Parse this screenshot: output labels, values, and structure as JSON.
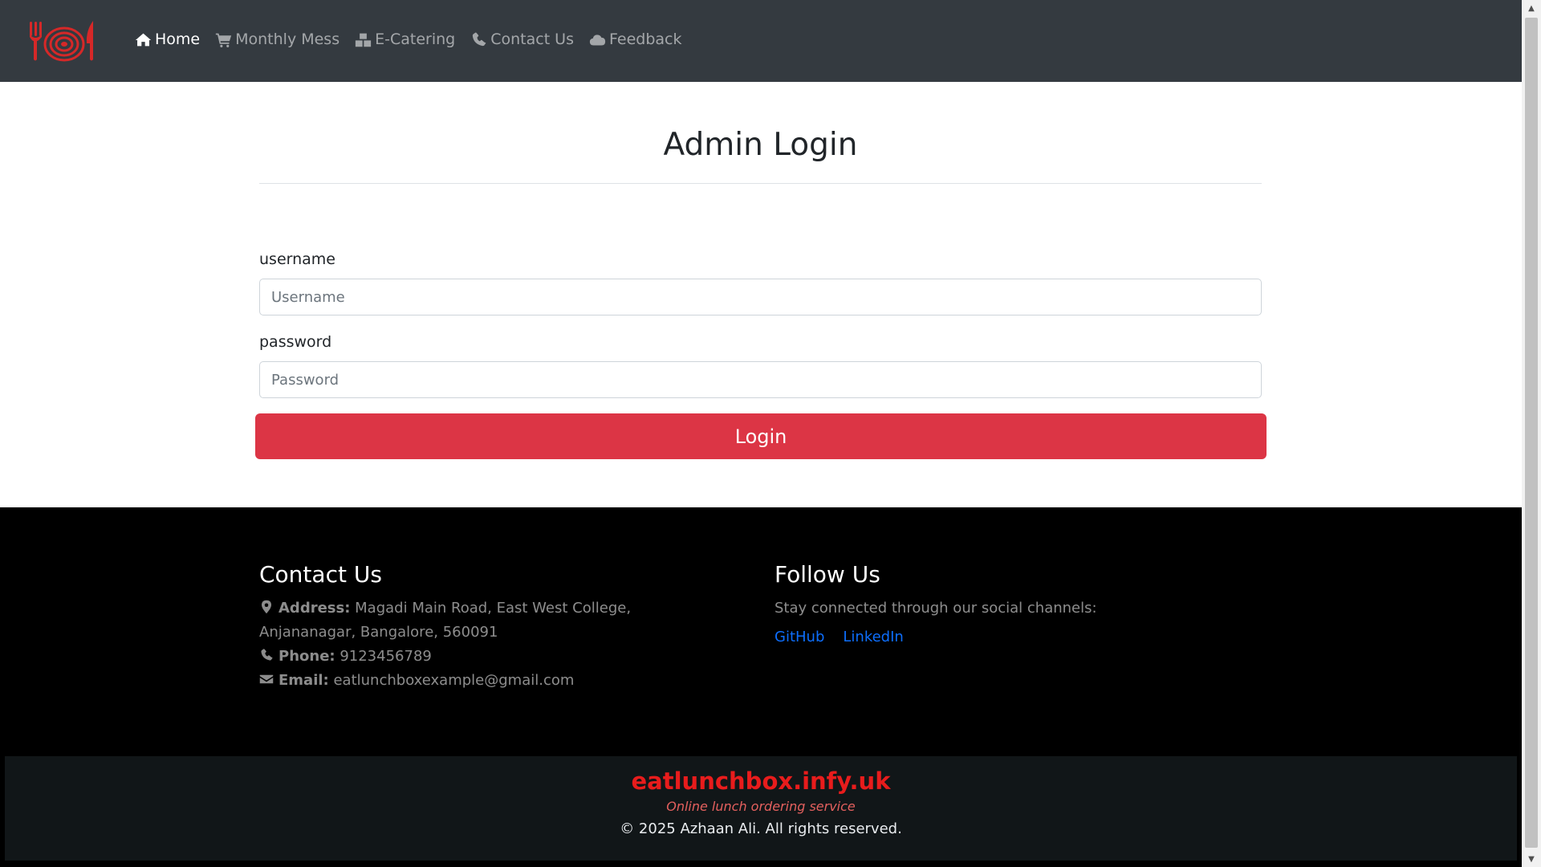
{
  "nav": {
    "logo_icon": "fork-plate-knife-logo",
    "brand_color": "#d62828",
    "items": [
      {
        "label": "Home",
        "icon": "home-icon",
        "active": true
      },
      {
        "label": "Monthly Mess",
        "icon": "cart-icon",
        "active": false
      },
      {
        "label": "E-Catering",
        "icon": "boxes-icon",
        "active": false
      },
      {
        "label": "Contact Us",
        "icon": "phone-icon",
        "active": false
      },
      {
        "label": "Feedback",
        "icon": "cloud-icon",
        "active": false
      }
    ]
  },
  "login": {
    "title": "Admin Login",
    "username_label": "username",
    "username_placeholder": "Username",
    "username_value": "",
    "password_label": "password",
    "password_placeholder": "Password",
    "password_value": "",
    "submit_label": "Login",
    "submit_color": "#dc3545"
  },
  "footer": {
    "contact": {
      "heading": "Contact Us",
      "address_label": "Address:",
      "address_value": "Magadi Main Road, East West College, Anjananagar, Bangalore, 560091",
      "phone_label": "Phone:",
      "phone_value": "9123456789",
      "email_label": "Email:",
      "email_value": "eatlunchboxexample@gmail.com"
    },
    "follow": {
      "heading": "Follow Us",
      "text": "Stay connected through our social channels:",
      "links": [
        "GitHub",
        "LinkedIn"
      ],
      "link_color": "#0d6efd"
    },
    "bottom": {
      "brand": "eatlunchbox.infy.uk",
      "tagline": "Online lunch ordering service",
      "copyright": "© 2025 Azhaan Ali. All rights reserved."
    }
  }
}
